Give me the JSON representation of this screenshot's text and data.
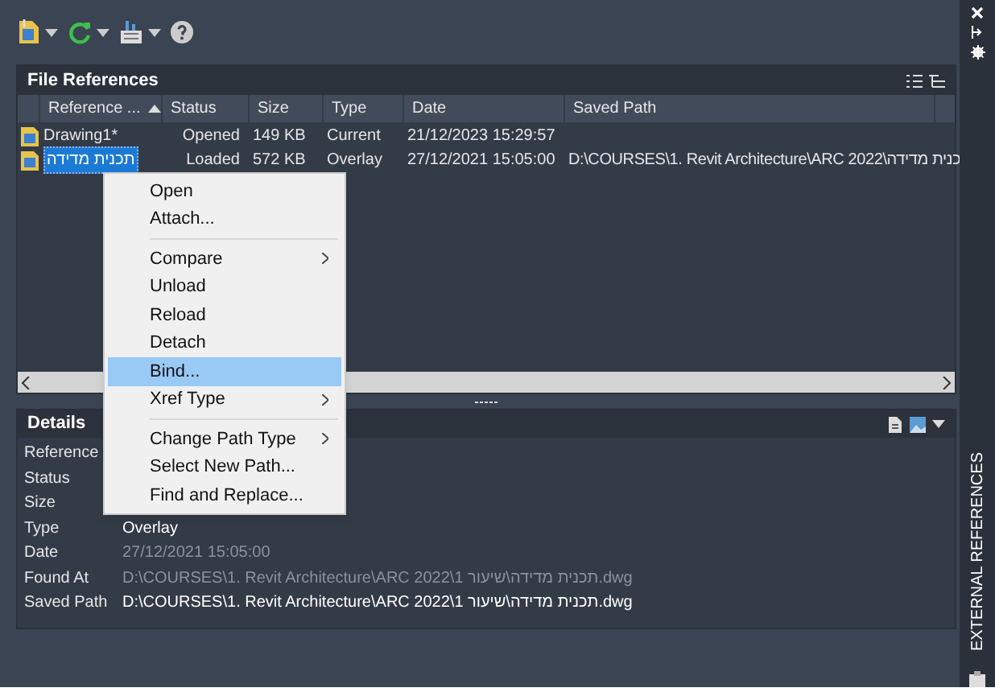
{
  "toolbar": {
    "buttons": [
      {
        "kind": "attach",
        "has_menu": true
      },
      {
        "kind": "refresh",
        "has_menu": true
      },
      {
        "kind": "bind",
        "has_menu": true
      },
      {
        "kind": "help",
        "has_menu": false
      }
    ]
  },
  "file_references": {
    "title": "File References",
    "columns": [
      {
        "label": "Reference ...",
        "sorted": true
      },
      {
        "label": "Status",
        "sorted": false
      },
      {
        "label": "Size",
        "sorted": false
      },
      {
        "label": "Type",
        "sorted": false
      },
      {
        "label": "Date",
        "sorted": false
      },
      {
        "label": "Saved Path",
        "sorted": false
      }
    ],
    "rows": [
      {
        "selected": false,
        "cells": [
          "Drawing1*",
          "Opened",
          "149 KB",
          "Current",
          "21/12/2023 15:29:57",
          ""
        ]
      },
      {
        "selected": true,
        "cells": [
          "תכנית מדידה",
          "Loaded",
          "572 KB",
          "Overlay",
          "27/12/2021 15:05:00",
          "D:\\COURSES\\1. Revit Architecture\\ARC 2022\\כנית מדידה"
        ]
      }
    ]
  },
  "context_menu": {
    "items": [
      {
        "kind": "item",
        "label": "Open",
        "submenu": false,
        "selected": false
      },
      {
        "kind": "item",
        "label": "Attach...",
        "submenu": false,
        "selected": false
      },
      {
        "kind": "separator"
      },
      {
        "kind": "item",
        "label": "Compare",
        "submenu": true,
        "selected": false
      },
      {
        "kind": "item",
        "label": "Unload",
        "submenu": false,
        "selected": false
      },
      {
        "kind": "item",
        "label": "Reload",
        "submenu": false,
        "selected": false
      },
      {
        "kind": "item",
        "label": "Detach",
        "submenu": false,
        "selected": false
      },
      {
        "kind": "item",
        "label": "Bind...",
        "submenu": false,
        "selected": true
      },
      {
        "kind": "item",
        "label": "Xref Type",
        "submenu": true,
        "selected": false
      },
      {
        "kind": "separator"
      },
      {
        "kind": "item",
        "label": "Change Path Type",
        "submenu": true,
        "selected": false
      },
      {
        "kind": "item",
        "label": "Select New Path...",
        "submenu": false,
        "selected": false
      },
      {
        "kind": "item",
        "label": "Find and Replace...",
        "submenu": false,
        "selected": false
      }
    ]
  },
  "details": {
    "title": "Details",
    "rows": [
      {
        "label": "Reference"
      },
      {
        "label": "Status"
      },
      {
        "label": "Size"
      },
      {
        "label": "Type",
        "value": "Overlay",
        "disabled": false
      },
      {
        "label": "Date",
        "value": "27/12/2021 15:05:00",
        "disabled": true
      },
      {
        "label": "Found At",
        "value": "D:\\COURSES\\1. Revit Architecture\\ARC 2022\\תכנית מדידה\\שיעור 1.dwg",
        "disabled": true
      },
      {
        "label": "Saved Path",
        "value": "D:\\COURSES\\1. Revit Architecture\\ARC 2022\\תכנית מדידה\\שיעור 1.dwg",
        "disabled": false
      }
    ]
  },
  "side_tab": {
    "label": "EXTERNAL REFERENCES"
  }
}
